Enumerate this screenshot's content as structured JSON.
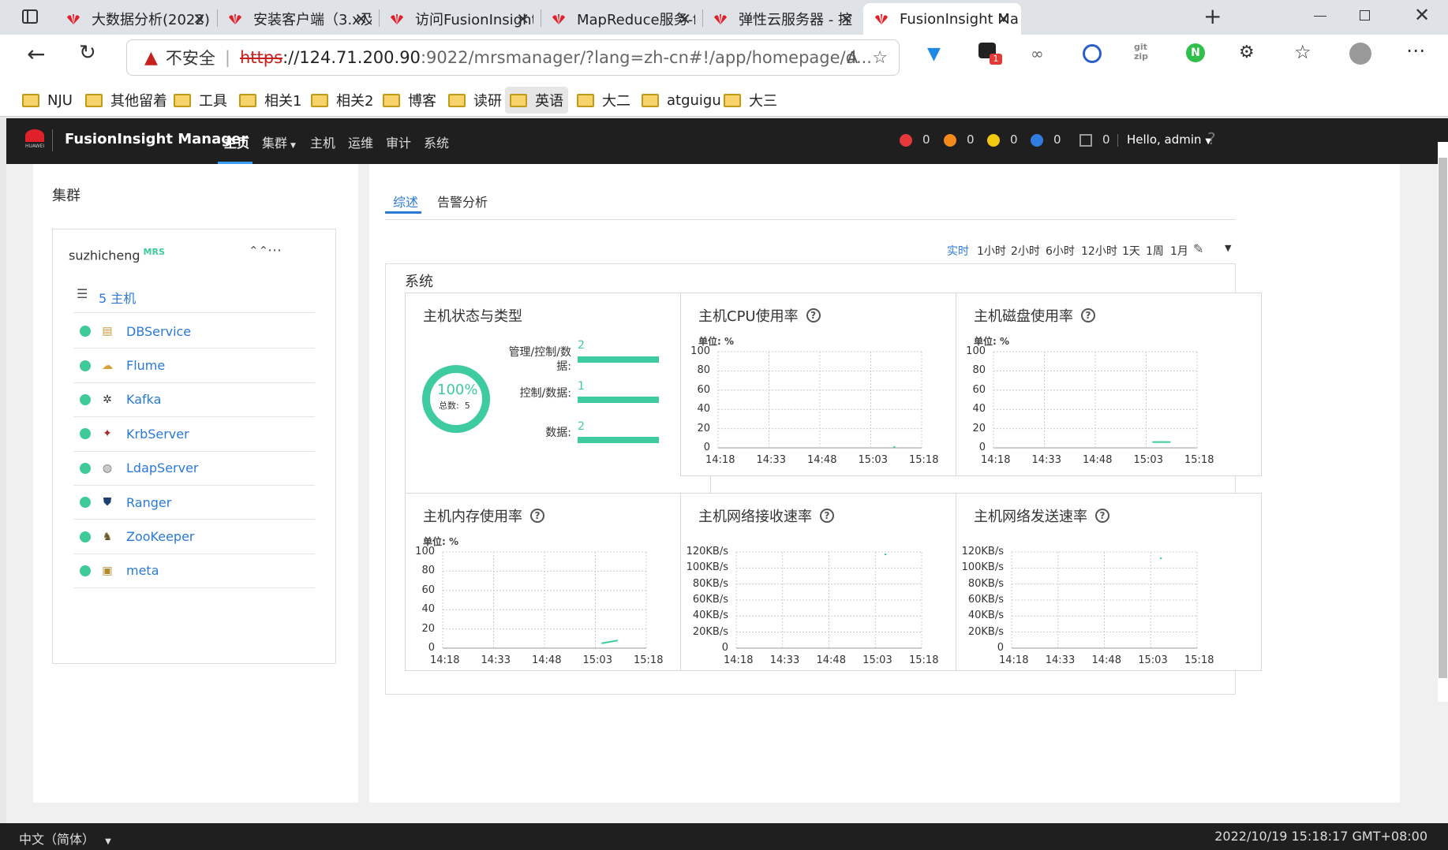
{
  "browser": {
    "tabs": [
      {
        "title": "大数据分析(2022)"
      },
      {
        "title": "安装客户端（3.x及"
      },
      {
        "title": "访问FusionInsight"
      },
      {
        "title": "MapReduce服务-f"
      },
      {
        "title": "弹性云服务器 - 控"
      },
      {
        "title": "FusionInsight Ma",
        "active": true
      }
    ],
    "url": {
      "insecure_label": "不安全",
      "scheme": "https",
      "host": "://124.71.200.90",
      "rest": ":9022/mrsmanager/?lang=zh-cn#!/app/homepage/d..."
    },
    "extension_badge": "1",
    "bookmarks": [
      "NJU",
      "其他留着",
      "工具",
      "相关1",
      "相关2",
      "博客",
      "读研",
      "英语",
      "大二",
      "atguigu",
      "大三"
    ]
  },
  "app": {
    "logo_sub": "HUAWEI",
    "name": "FusionInsight Manager",
    "nav": [
      "主页",
      "集群",
      "主机",
      "运维",
      "审计",
      "系统"
    ],
    "alarms": [
      {
        "color": "#e5383b",
        "count": "0",
        "icon": "critical-alarm-icon"
      },
      {
        "color": "#f28b1c",
        "count": "0",
        "icon": "major-alarm-icon"
      },
      {
        "color": "#f2c811",
        "count": "0",
        "icon": "minor-alarm-icon"
      },
      {
        "color": "#2f7de1",
        "count": "0",
        "icon": "info-alarm-icon"
      }
    ],
    "tasks_count": "0",
    "user": "Hello, admin",
    "help": "?"
  },
  "left": {
    "title": "集群",
    "cluster_name": "suzhicheng",
    "cluster_tag": "MRS",
    "hosts_link": "5 主机",
    "services": [
      {
        "name": "DBService",
        "icon": "database-icon"
      },
      {
        "name": "Flume",
        "icon": "flume-icon"
      },
      {
        "name": "Kafka",
        "icon": "kafka-icon"
      },
      {
        "name": "KrbServer",
        "icon": "krbserver-icon"
      },
      {
        "name": "LdapServer",
        "icon": "ldap-icon"
      },
      {
        "name": "Ranger",
        "icon": "ranger-icon"
      },
      {
        "name": "ZooKeeper",
        "icon": "zookeeper-icon"
      },
      {
        "name": "meta",
        "icon": "meta-icon"
      }
    ]
  },
  "main": {
    "subtabs": [
      "综述",
      "告警分析"
    ],
    "time_ranges": [
      "实时",
      "1小时",
      "2小时",
      "6小时",
      "12小时",
      "1天",
      "1周",
      "1月"
    ],
    "section_title": "系统",
    "host_status": {
      "title": "主机状态与类型",
      "percent": "100%",
      "total_label": "总数:",
      "total": "5",
      "fraction": 1.0,
      "rows": [
        {
          "label": "管理/控制/数据:",
          "value": "2",
          "fraction": 1.0
        },
        {
          "label": "控制/数据:",
          "value": "1",
          "fraction": 1.0
        },
        {
          "label": "数据:",
          "value": "2",
          "fraction": 1.0
        }
      ]
    },
    "accent": "#3ecba0"
  },
  "chart_data": [
    {
      "type": "line",
      "title": "主机CPU使用率",
      "unit": "单位: %",
      "yticks": [
        "0",
        "20",
        "40",
        "60",
        "80",
        "100"
      ],
      "ylim": [
        0,
        100
      ],
      "x": [
        "14:18",
        "14:33",
        "14:48",
        "15:03",
        "15:18"
      ],
      "series": [
        {
          "points": [
            [
              0.86,
              0.5
            ],
            [
              0.87,
              1
            ]
          ]
        }
      ]
    },
    {
      "type": "line",
      "title": "主机磁盘使用率",
      "unit": "单位: %",
      "yticks": [
        "0",
        "20",
        "40",
        "60",
        "80",
        "100"
      ],
      "ylim": [
        0,
        100
      ],
      "x": [
        "14:18",
        "14:33",
        "14:48",
        "15:03",
        "15:18"
      ],
      "series": [
        {
          "points": [
            [
              0.78,
              6
            ],
            [
              0.87,
              6
            ]
          ]
        }
      ]
    },
    {
      "type": "line",
      "title": "主机内存使用率",
      "unit": "单位: %",
      "yticks": [
        "0",
        "20",
        "40",
        "60",
        "80",
        "100"
      ],
      "ylim": [
        0,
        100
      ],
      "x": [
        "14:18",
        "14:33",
        "14:48",
        "15:03",
        "15:18"
      ],
      "series": [
        {
          "points": [
            [
              0.78,
              5
            ],
            [
              0.86,
              8
            ]
          ]
        }
      ]
    },
    {
      "type": "line",
      "title": "主机网络接收速率",
      "unit": "",
      "yticks": [
        "0",
        "20KB/s",
        "40KB/s",
        "60KB/s",
        "80KB/s",
        "100KB/s",
        "120KB/s"
      ],
      "ylim": [
        0,
        120
      ],
      "x": [
        "14:18",
        "14:33",
        "14:48",
        "15:03",
        "15:18"
      ],
      "series": [
        {
          "points": [
            [
              0.8,
              117
            ],
            [
              0.81,
              117
            ]
          ]
        }
      ]
    },
    {
      "type": "line",
      "title": "主机网络发送速率",
      "unit": "",
      "yticks": [
        "0",
        "20KB/s",
        "40KB/s",
        "60KB/s",
        "80KB/s",
        "100KB/s",
        "120KB/s"
      ],
      "ylim": [
        0,
        120
      ],
      "x": [
        "14:18",
        "14:33",
        "14:48",
        "15:03",
        "15:18"
      ],
      "series": [
        {
          "points": [
            [
              0.8,
              112
            ],
            [
              0.81,
              112
            ]
          ]
        }
      ]
    }
  ],
  "footer": {
    "lang": "中文（简体）",
    "datetime": "2022/10/19 15:18:17 GMT+08:00"
  }
}
